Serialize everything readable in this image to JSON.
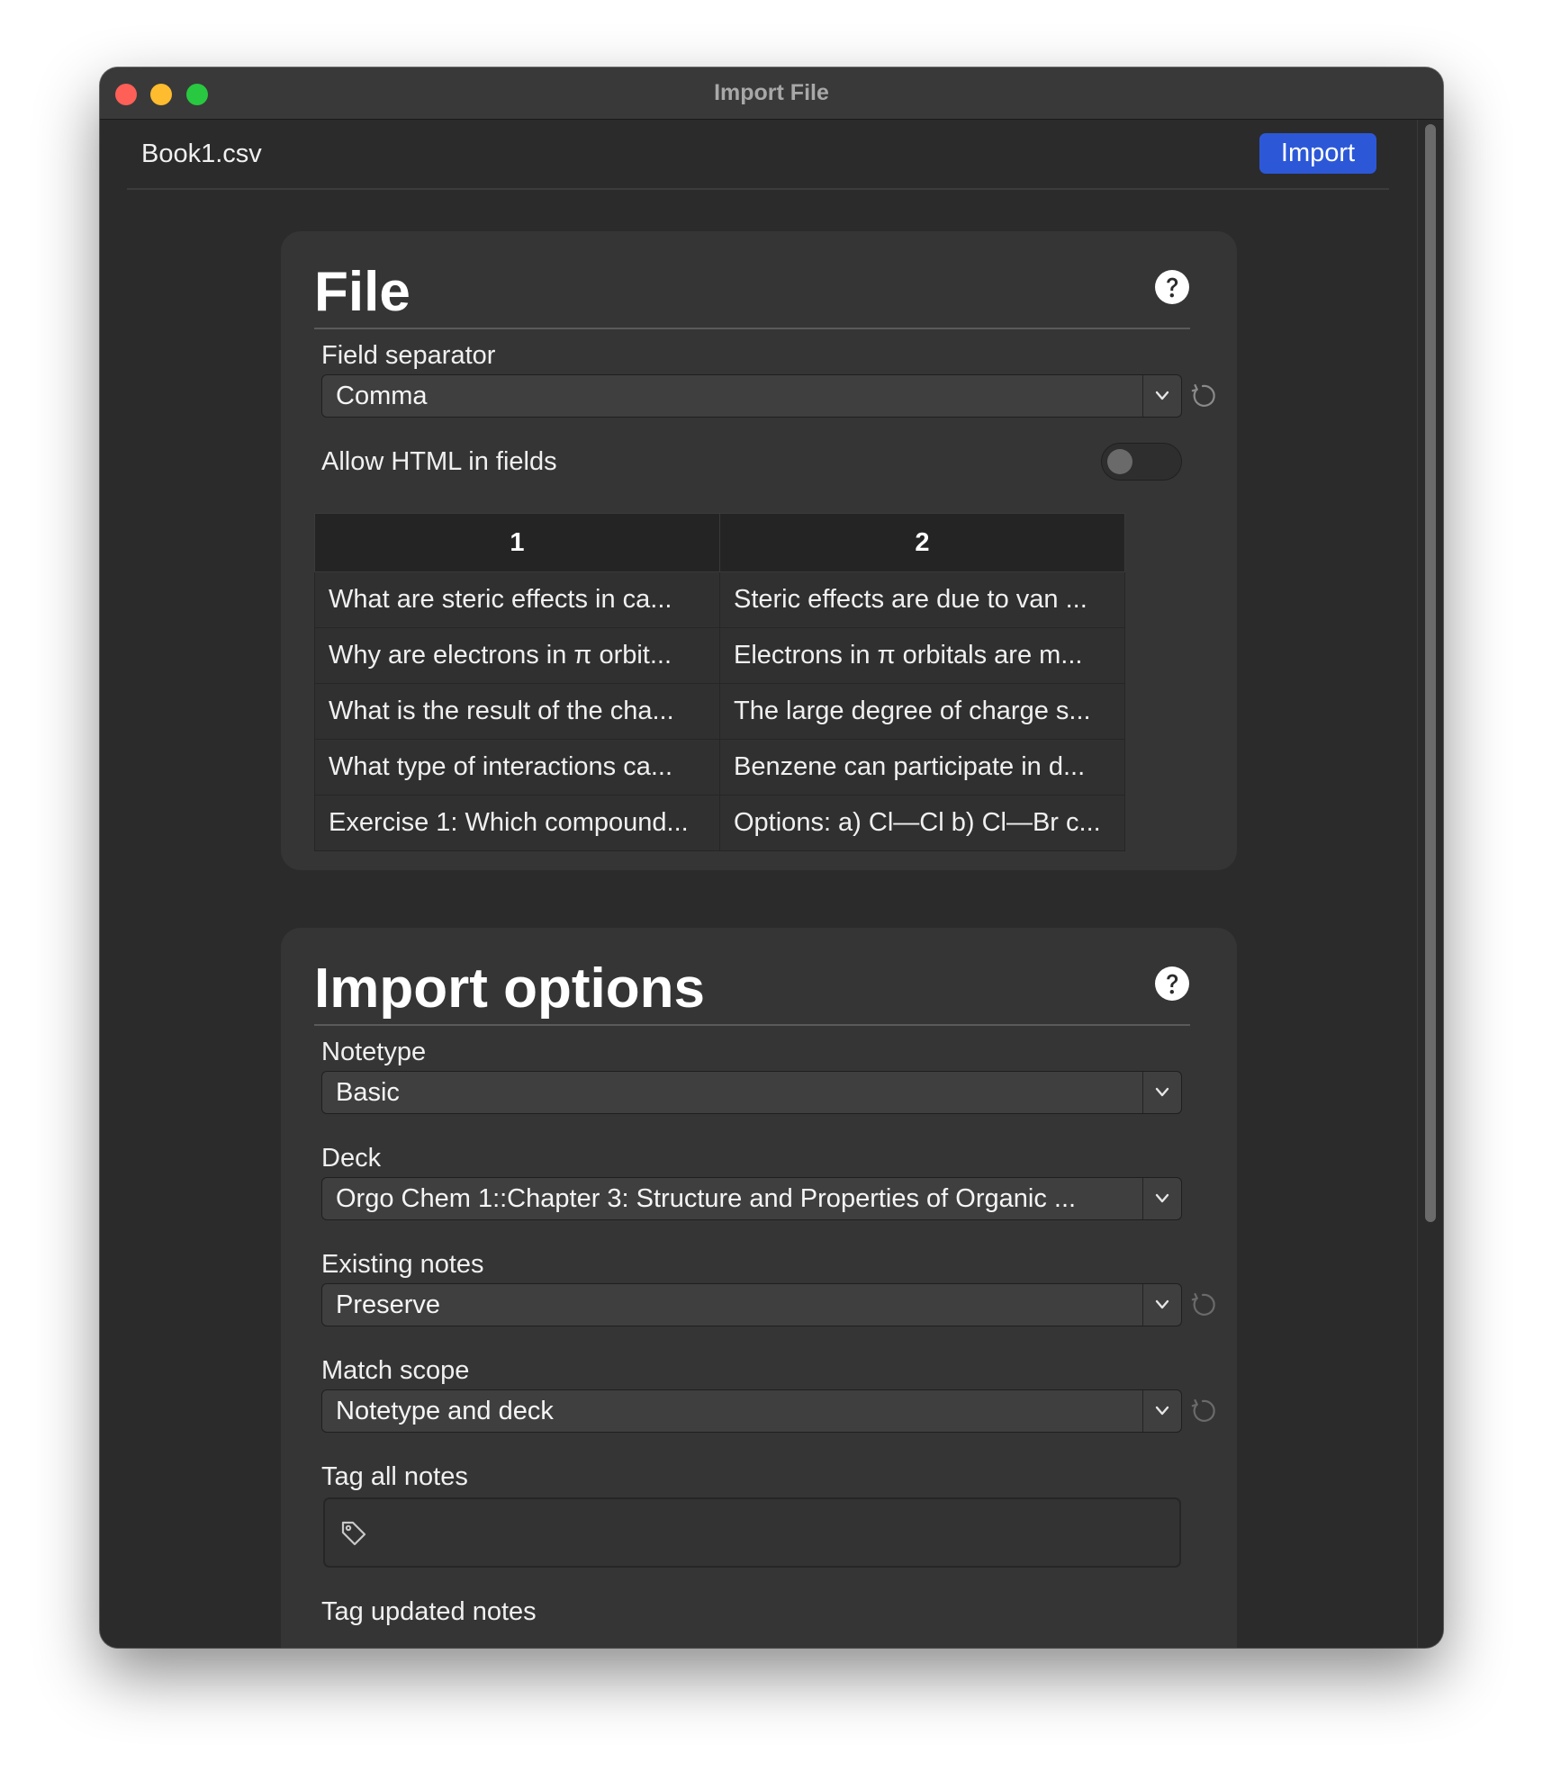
{
  "window": {
    "title": "Import File"
  },
  "header": {
    "filename": "Book1.csv",
    "import_label": "Import"
  },
  "file_section": {
    "title": "File",
    "field_separator": {
      "label": "Field separator",
      "value": "Comma"
    },
    "allow_html": {
      "label": "Allow HTML in fields",
      "enabled": false
    },
    "preview": {
      "columns": [
        "1",
        "2"
      ],
      "rows": [
        [
          "What are steric effects in ca...",
          "Steric effects are due to van ..."
        ],
        [
          "Why are electrons in π orbit...",
          "Electrons in π orbitals are m..."
        ],
        [
          "What is the result of the cha...",
          "The large degree of charge s..."
        ],
        [
          "What type of interactions ca...",
          "Benzene can participate in d..."
        ],
        [
          "Exercise 1: Which compound...",
          "Options: a) Cl—Cl b) Cl—Br c..."
        ]
      ]
    }
  },
  "options_section": {
    "title": "Import options",
    "notetype": {
      "label": "Notetype",
      "value": "Basic"
    },
    "deck": {
      "label": "Deck",
      "value": "Orgo Chem 1::Chapter 3: Structure and Properties of Organic ..."
    },
    "existing_notes": {
      "label": "Existing notes",
      "value": "Preserve"
    },
    "match_scope": {
      "label": "Match scope",
      "value": "Notetype and deck"
    },
    "tag_all": {
      "label": "Tag all notes",
      "value": ""
    },
    "tag_updated": {
      "label": "Tag updated notes"
    }
  },
  "colors": {
    "accent": "#2c58d8",
    "window_bg": "#2b2b2b",
    "card_bg": "#353535",
    "titlebar_bg": "#393939"
  },
  "icons": {
    "help": "question-circle-icon",
    "reset": "revert-arrow-icon",
    "chevron": "chevron-down-icon",
    "tag": "tag-icon"
  }
}
